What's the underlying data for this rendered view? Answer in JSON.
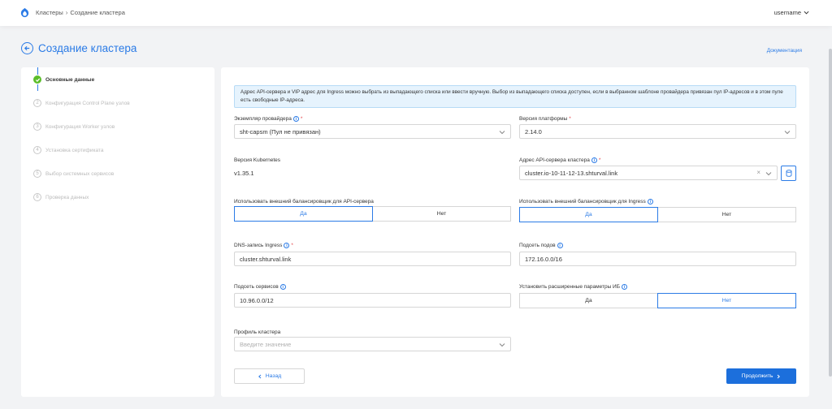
{
  "header": {
    "breadcrumbs": [
      "Кластеры",
      "Создание кластера"
    ],
    "breadcrumb_separator": "›",
    "username": "username"
  },
  "page": {
    "title": "Создание кластера",
    "doc_link": "Документация"
  },
  "steps": [
    {
      "num": "1",
      "label": "Основные данные",
      "status": "done"
    },
    {
      "num": "2",
      "label": "Конфигурация Control Plane узлов",
      "status": "pending"
    },
    {
      "num": "3",
      "label": "Конфигурация Worker узлов",
      "status": "pending"
    },
    {
      "num": "4",
      "label": "Установка сертификата",
      "status": "pending"
    },
    {
      "num": "5",
      "label": "Выбор системных сервисов",
      "status": "pending"
    },
    {
      "num": "6",
      "label": "Проверка данных",
      "status": "pending"
    }
  ],
  "info_text": "Адрес API-сервера и VIP адрес для Ingress можно выбрать из выпадающего списка или ввести вручную. Выбор из выпадающего списка доступен, если в выбранном шаблоне провайдера привязан пул IP-адресов и в этом пуле есть свободные IP-адреса.",
  "form": {
    "provider": {
      "label": "Экземпляр провайдера",
      "value": "sht-capsm (Пул не привязан)"
    },
    "platform_version": {
      "label": "Версия платформы",
      "value": "2.14.0"
    },
    "k8s_version": {
      "label": "Версия Kubernetes",
      "value": "v1.35.1"
    },
    "api_address": {
      "label": "Адрес API-сервера кластера",
      "value": "cluster.io-10-11-12-13.shturval.link"
    },
    "api_lb": {
      "label": "Использовать внешний балансировщик для API-сервера",
      "yes": "Да",
      "no": "Нет",
      "selected": "yes"
    },
    "ingress_lb": {
      "label": "Использовать внешний балансировщик для Ingress",
      "yes": "Да",
      "no": "Нет",
      "selected": "yes"
    },
    "dns_ingress": {
      "label": "DNS-запись Ingress",
      "value": "cluster.shturval.link"
    },
    "pod_subnet": {
      "label": "Подсеть подов",
      "value": "172.16.0.0/16"
    },
    "service_subnet": {
      "label": "Подсеть сервисов",
      "value": "10.96.0.0/12"
    },
    "advanced_params": {
      "label": "Установить расширенные параметры ИБ",
      "yes": "Да",
      "no": "Нет",
      "selected": "no"
    },
    "cluster_profile": {
      "label": "Профиль кластера",
      "placeholder": "Введите значение"
    }
  },
  "actions": {
    "back": "Назад",
    "next": "Продолжить"
  },
  "colors": {
    "accent": "#2b7be6",
    "primary_button": "#1c6fdc",
    "success": "#5bbd2a",
    "required": "#e5484d"
  }
}
